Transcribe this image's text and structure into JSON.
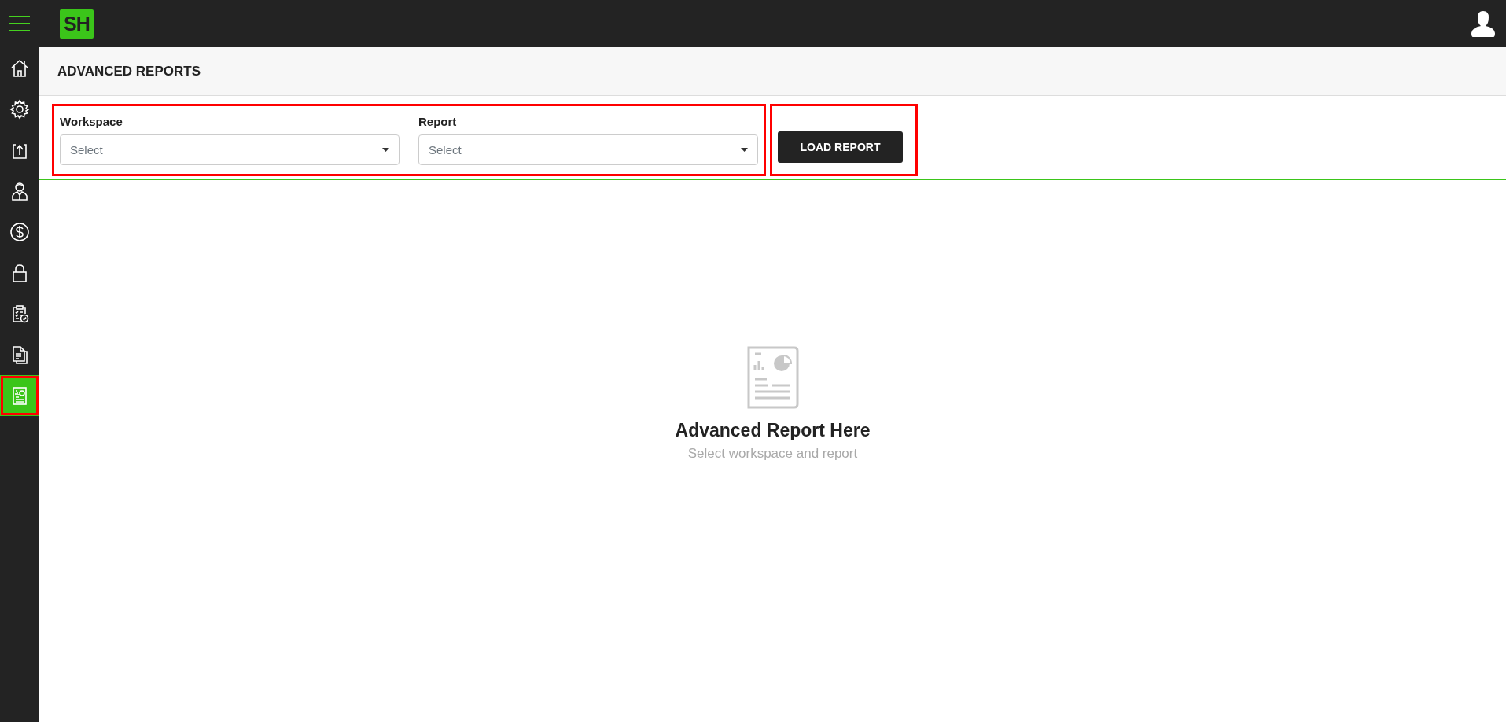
{
  "topbar": {
    "logo": "SH"
  },
  "sidebar": {
    "items": [
      {
        "kind": "home",
        "selected": false,
        "highlighted": false
      },
      {
        "kind": "settings",
        "selected": false,
        "highlighted": false
      },
      {
        "kind": "upload",
        "selected": false,
        "highlighted": false
      },
      {
        "kind": "person",
        "selected": false,
        "highlighted": false
      },
      {
        "kind": "dollar",
        "selected": false,
        "highlighted": false
      },
      {
        "kind": "lock",
        "selected": false,
        "highlighted": false
      },
      {
        "kind": "clipboard",
        "selected": false,
        "highlighted": false
      },
      {
        "kind": "document",
        "selected": false,
        "highlighted": false
      },
      {
        "kind": "report",
        "selected": true,
        "highlighted": true
      }
    ]
  },
  "page": {
    "title": "ADVANCED REPORTS"
  },
  "filters": {
    "highlighted": true,
    "fields": [
      {
        "label": "Workspace",
        "placeholder": "Select"
      },
      {
        "label": "Report",
        "placeholder": "Select"
      }
    ]
  },
  "load_button": {
    "label": "LOAD REPORT",
    "highlighted": true
  },
  "empty_state": {
    "title": "Advanced Report Here",
    "subtitle": "Select workspace and report"
  }
}
